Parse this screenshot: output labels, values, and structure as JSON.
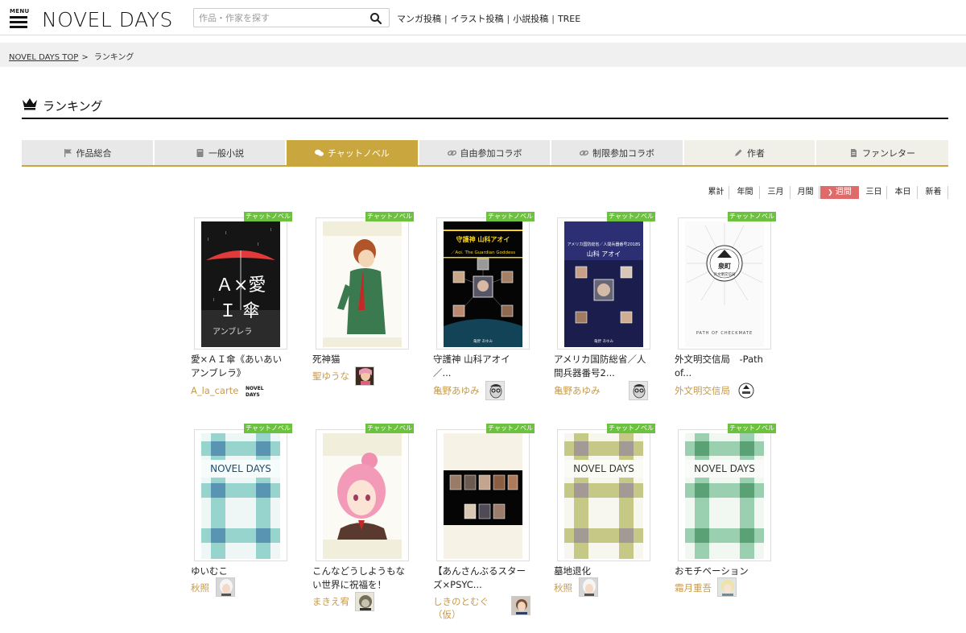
{
  "header": {
    "menu_label": "MENU",
    "logo_text": "NOVEL DAYS",
    "search_placeholder": "作品・作家を探す",
    "links": [
      "マンガ投稿",
      "イラスト投稿",
      "小説投稿",
      "TREE"
    ]
  },
  "breadcrumb": {
    "home": "NOVEL DAYS TOP",
    "arrow": ">",
    "current": "ランキング"
  },
  "page_title": "ランキング",
  "tabs": [
    {
      "label": "作品総合",
      "icon": "flag-icon"
    },
    {
      "label": "一般小説",
      "icon": "book-icon"
    },
    {
      "label": "チャットノベル",
      "icon": "chat-icon",
      "active": true
    },
    {
      "label": "自由参加コラボ",
      "icon": "link-icon"
    },
    {
      "label": "制限参加コラボ",
      "icon": "link-icon"
    },
    {
      "label": "作者",
      "icon": "pen-icon"
    },
    {
      "label": "ファンレター",
      "icon": "document-icon"
    }
  ],
  "periods": [
    "累計",
    "年間",
    "三月",
    "月間",
    "週間",
    "三日",
    "本日",
    "新着"
  ],
  "active_period": "週間",
  "badge_label": "チャットノベル",
  "works": [
    {
      "title": "愛×ＡＩ傘《あいあいアンブレラ》",
      "author": "A_la_carte",
      "cover": "umbrella",
      "avatar": "novel-days-logo"
    },
    {
      "title": "死神猫",
      "author": "聖ゆうな",
      "cover": "illustration-boy",
      "avatar": "illustration"
    },
    {
      "title": "守護神 山科アオイ／...",
      "author": "亀野あゆみ",
      "cover": "guardian",
      "avatar": "glasses-man"
    },
    {
      "title": "アメリカ国防総省／人間兵器番号2...",
      "author": "亀野あゆみ",
      "cover": "pentagon",
      "avatar": "glasses-man"
    },
    {
      "title": "外文明交信局　-Path of...",
      "author": "外文明交信局",
      "cover": "emblem",
      "avatar": "emblem"
    },
    {
      "title": "ゆいむこ",
      "author": "秋照",
      "cover": "plaid-teal",
      "avatar": "white-hair"
    },
    {
      "title": "こんなどうしようもない世界に祝福を！",
      "author": "まきえ宥",
      "cover": "illustration-girl",
      "avatar": "sketch"
    },
    {
      "title": "【あんさんぶるスターズ×PSYC...",
      "author": "しきのとむぐ（仮）",
      "cover": "group",
      "avatar": "illustration"
    },
    {
      "title": "墓地退化",
      "author": "秋照",
      "cover": "plaid-olive",
      "avatar": "white-hair"
    },
    {
      "title": "おモチベーション",
      "author": "霜月重吾",
      "cover": "plaid-green",
      "avatar": "blonde"
    }
  ],
  "cover_texts": {
    "plaid": "NOVEL DAYS",
    "umbrella_big": "Ａ×愛",
    "umbrella_big2": "Ｉ 傘",
    "umbrella_sub": "アンブレラ",
    "guardian_title": "守護神 山科アオイ",
    "guardian_sub": "／Aoi. The Guardian Goddess",
    "author_sign": "亀野 あゆみ",
    "pentagon_title": "アメリカ国防総省／人間兵器番号2018S",
    "pentagon_name": "山科 アオイ",
    "emblem_kanji": "泉町",
    "emblem_sub": "外文明交信局",
    "emblem_path": "PATH OF CHECKMATE"
  },
  "colors": {
    "accent": "#c9a63e",
    "badge": "#6cc13e",
    "author": "#c99a4b",
    "active_period": "#e06a6a"
  }
}
